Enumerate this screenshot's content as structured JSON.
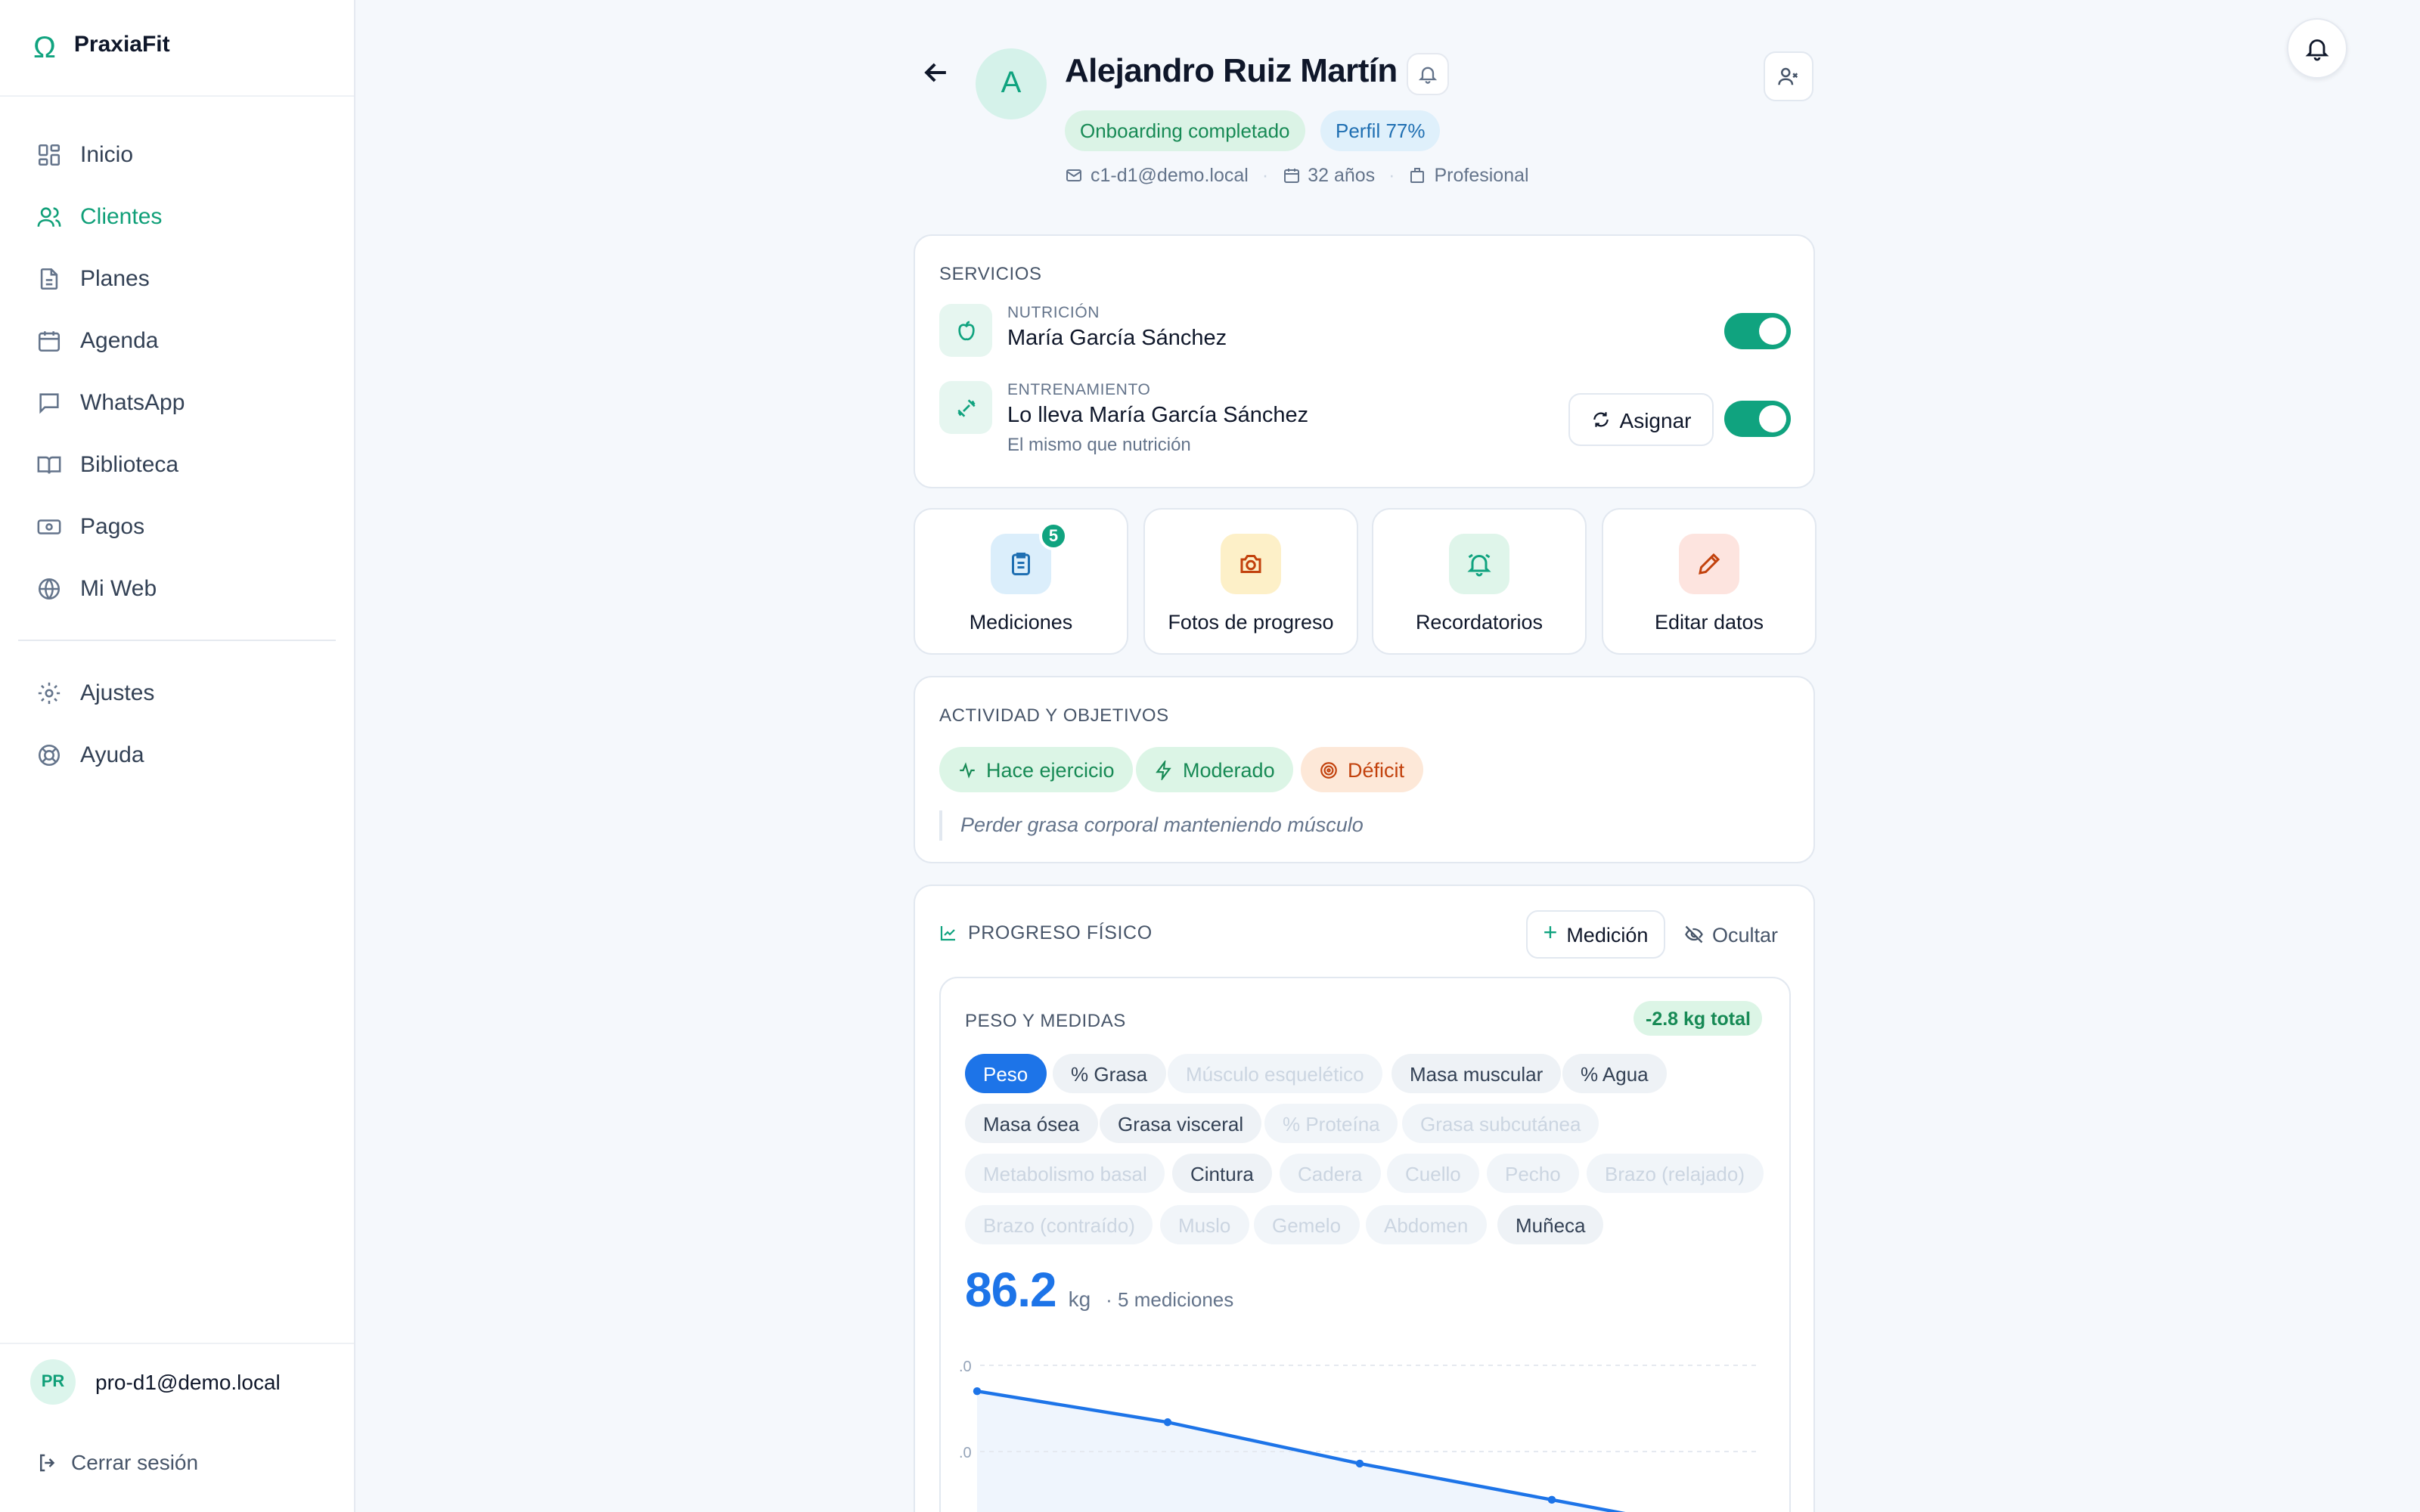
{
  "brand": {
    "name": "PraxiaFit",
    "logo": "Ω"
  },
  "sidebar": {
    "items": [
      {
        "label": "Inicio",
        "icon": "dashboard-icon"
      },
      {
        "label": "Clientes",
        "icon": "users-icon",
        "active": true
      },
      {
        "label": "Planes",
        "icon": "document-icon"
      },
      {
        "label": "Agenda",
        "icon": "calendar-icon"
      },
      {
        "label": "WhatsApp",
        "icon": "chat-icon"
      },
      {
        "label": "Biblioteca",
        "icon": "book-icon"
      },
      {
        "label": "Pagos",
        "icon": "money-icon"
      },
      {
        "label": "Mi Web",
        "icon": "globe-icon"
      }
    ],
    "secondary": [
      {
        "label": "Ajustes",
        "icon": "gear-icon"
      },
      {
        "label": "Ayuda",
        "icon": "lifebuoy-icon"
      }
    ],
    "user": {
      "initials": "PR",
      "email": "pro-d1@demo.local"
    },
    "logout_label": "Cerrar sesión"
  },
  "client": {
    "initial": "A",
    "name": "Alejandro Ruiz Martín",
    "badges": {
      "onboarding": "Onboarding completado",
      "profile": "Perfil 77%"
    },
    "email": "c1-d1@demo.local",
    "age": "32 años",
    "role": "Profesional"
  },
  "services": {
    "title": "SERVICIOS",
    "nutrition": {
      "label": "NUTRICIÓN",
      "professional": "María García Sánchez",
      "enabled": true
    },
    "training": {
      "label": "ENTRENAMIENTO",
      "professional": "Lo lleva María García Sánchez",
      "note": "El mismo que nutrición",
      "enabled": true
    },
    "assign_label": "Asignar"
  },
  "quick_actions": {
    "measurements": {
      "label": "Mediciones",
      "count": "5"
    },
    "photos": {
      "label": "Fotos de progreso"
    },
    "reminders": {
      "label": "Recordatorios"
    },
    "edit": {
      "label": "Editar datos"
    }
  },
  "activity": {
    "title": "ACTIVIDAD Y OBJETIVOS",
    "chips": [
      "Hace ejercicio",
      "Moderado",
      "Déficit"
    ],
    "goal": "Perder grasa corporal manteniendo músculo"
  },
  "progress": {
    "title": "PROGRESO FÍSICO",
    "add_label": "Medición",
    "hide_label": "Ocultar",
    "panel_title": "PESO Y MEDIDAS",
    "total_change": "-2.8 kg total",
    "metrics": [
      {
        "label": "Peso",
        "state": "selected"
      },
      {
        "label": "% Grasa",
        "state": "available"
      },
      {
        "label": "Músculo esquelético",
        "state": "empty"
      },
      {
        "label": "Masa muscular",
        "state": "available"
      },
      {
        "label": "% Agua",
        "state": "available"
      },
      {
        "label": "Masa ósea",
        "state": "available"
      },
      {
        "label": "Grasa visceral",
        "state": "available"
      },
      {
        "label": "% Proteína",
        "state": "empty"
      },
      {
        "label": "Grasa subcutánea",
        "state": "empty"
      },
      {
        "label": "Metabolismo basal",
        "state": "empty"
      },
      {
        "label": "Cintura",
        "state": "available"
      },
      {
        "label": "Cadera",
        "state": "empty"
      },
      {
        "label": "Cuello",
        "state": "empty"
      },
      {
        "label": "Pecho",
        "state": "empty"
      },
      {
        "label": "Brazo (relajado)",
        "state": "empty"
      },
      {
        "label": "Brazo (contraído)",
        "state": "empty"
      },
      {
        "label": "Muslo",
        "state": "empty"
      },
      {
        "label": "Gemelo",
        "state": "empty"
      },
      {
        "label": "Abdomen",
        "state": "empty"
      },
      {
        "label": "Muñeca",
        "state": "available"
      }
    ],
    "current_value": "86.2",
    "unit": "kg",
    "count_label": "· 5 mediciones"
  },
  "chart_data": {
    "type": "line",
    "series": [
      {
        "values": [
          89.0,
          88.4,
          87.6,
          86.9,
          86.2
        ]
      }
    ],
    "y_tick_labels": [
      ".0",
      ".0"
    ],
    "grid": true
  },
  "colors": {
    "accent": "#10a37f",
    "chart": "#1d74e8"
  }
}
